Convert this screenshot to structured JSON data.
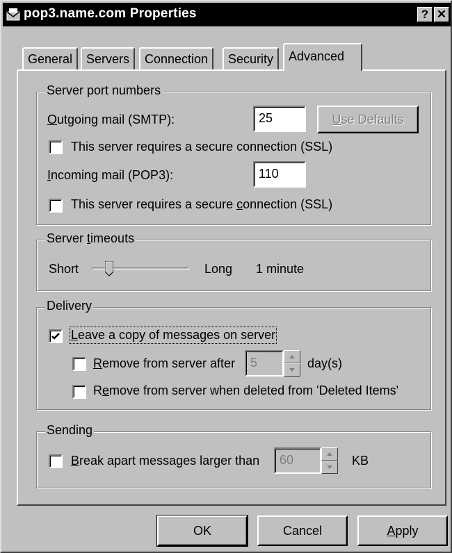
{
  "window": {
    "title": "pop3.name.com Properties",
    "help_label": "?",
    "close_label": "✕"
  },
  "tabs": [
    {
      "label": "General",
      "active": false
    },
    {
      "label": "Servers",
      "active": false
    },
    {
      "label": "Connection",
      "active": false
    },
    {
      "label": "Security",
      "active": false
    },
    {
      "label": "Advanced",
      "active": true
    }
  ],
  "ports": {
    "legend": "Server port numbers",
    "outgoing_label_u": "O",
    "outgoing_label_rest": "utgoing mail (SMTP):",
    "outgoing_value": "25",
    "use_defaults_u": "U",
    "use_defaults_rest": "se Defaults",
    "outgoing_ssl_label": "This server requires a secure connection (SSL)",
    "outgoing_ssl_checked": false,
    "incoming_label_u": "I",
    "incoming_label_rest": "ncoming mail (POP3):",
    "incoming_value": "110",
    "incoming_ssl_pre": "This server requires a secure ",
    "incoming_ssl_u": "c",
    "incoming_ssl_post": "onnection (SSL)",
    "incoming_ssl_checked": false
  },
  "timeouts": {
    "legend_pre": "Server ",
    "legend_u": "t",
    "legend_post": "imeouts",
    "short_label": "Short",
    "long_label": "Long",
    "value_label": "1 minute",
    "slider_position": 0.15
  },
  "delivery": {
    "legend": "Delivery",
    "leave_copy_u": "L",
    "leave_copy_rest": "eave a copy of messages on server",
    "leave_copy_checked": true,
    "remove_after_u": "R",
    "remove_after_rest": "emove from server after",
    "remove_after_checked": false,
    "remove_after_value": "5",
    "days_label": "day(s)",
    "remove_deleted_pre": "R",
    "remove_deleted_u": "e",
    "remove_deleted_post": "move from server when deleted from 'Deleted Items'",
    "remove_deleted_checked": false
  },
  "sending": {
    "legend": "Sending",
    "break_apart_u": "B",
    "break_apart_rest": "reak apart messages larger than",
    "break_apart_checked": false,
    "break_apart_value": "60",
    "kb_label": "KB"
  },
  "buttons": {
    "ok": "OK",
    "cancel": "Cancel",
    "apply_u": "A",
    "apply_rest": "pply"
  },
  "icons": {
    "title_icon": "mail-envelope-icon",
    "check": "checkmark-icon",
    "spin_up": "spin-up-arrow-icon",
    "spin_down": "spin-down-arrow-icon"
  }
}
